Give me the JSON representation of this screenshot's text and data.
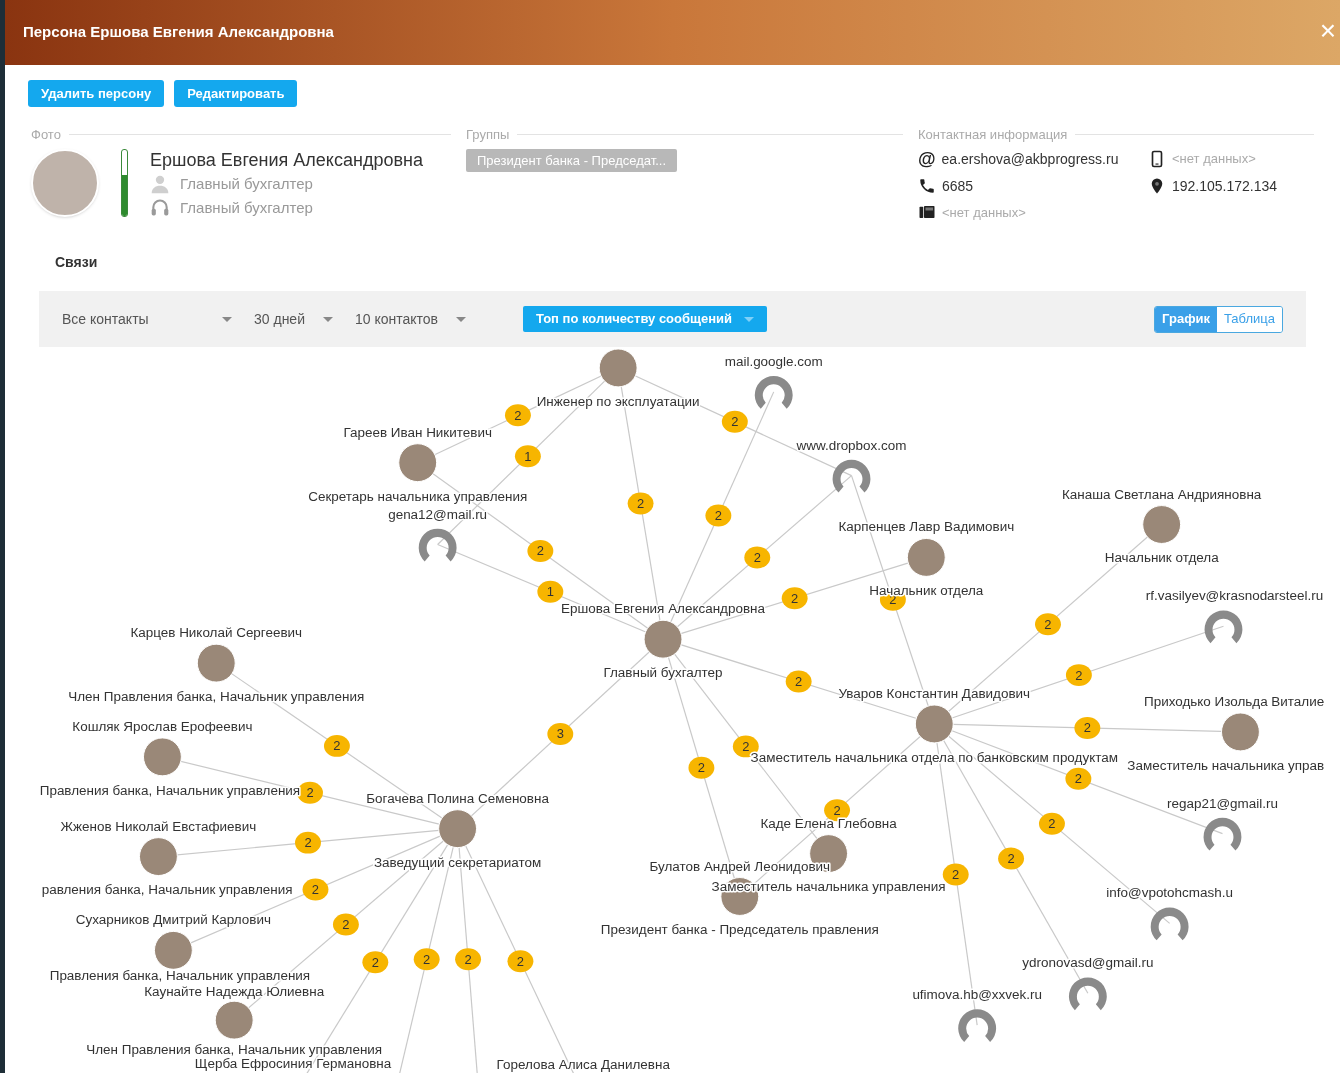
{
  "window": {
    "title": "Персона Ершова Евгения Александровна",
    "close": "×"
  },
  "actions": [
    "Удалить персону",
    "Редактировать"
  ],
  "photo": {
    "legend": "Фото",
    "level": 0.62,
    "name": "Ершова Евгения Александровна",
    "roles": [
      {
        "kind": "user",
        "text": "Главный бухгалтер"
      },
      {
        "kind": "headset",
        "text": "Главный бухгалтер"
      }
    ]
  },
  "groups": {
    "legend": "Группы",
    "tags": [
      "Президент банка - Председат..."
    ]
  },
  "contacts": {
    "legend": "Контактная информация",
    "items": [
      {
        "kind": "email",
        "icon": "@",
        "value": "ea.ershova@akbprogress.ru",
        "missing": false
      },
      {
        "kind": "mobile",
        "value": "<нет данных>",
        "missing": true
      },
      {
        "kind": "phone",
        "value": "6685",
        "missing": false
      },
      {
        "kind": "ip",
        "value": "192.105.172.134",
        "missing": false
      },
      {
        "kind": "fax",
        "value": "<нет данных>",
        "missing": true
      }
    ]
  },
  "links": {
    "title": "Связи",
    "filters": [
      {
        "kind": "plain",
        "label": "Все контакты"
      },
      {
        "kind": "plain",
        "label": "30 дней"
      },
      {
        "kind": "plain",
        "label": "10 контактов"
      },
      {
        "kind": "primary",
        "label": "Топ по количеству сообщений"
      }
    ],
    "views": [
      {
        "label": "График",
        "selected": true
      },
      {
        "label": "Таблица",
        "selected": false
      }
    ],
    "nodes": [
      {
        "kind": "person",
        "role": "Инженер по эксплуатации"
      },
      {
        "kind": "unknown",
        "name": "mail.google.com"
      },
      {
        "kind": "person",
        "name": "Гареев Иван Никитевич",
        "role": "Секретарь начальника управления"
      },
      {
        "kind": "unknown",
        "name": "www.dropbox.com"
      },
      {
        "kind": "person",
        "name": "Канаша Светлана Андрияновна",
        "role": "Начальник отдела"
      },
      {
        "kind": "unknown",
        "name": "gena12@mail.ru"
      },
      {
        "kind": "person",
        "name": "Карпенцев Лавр Вадимович",
        "role": "Начальник отдела"
      },
      {
        "kind": "unknown",
        "name": "rf.vasilyev@krasnodarsteel.ru"
      },
      {
        "kind": "person",
        "name": "Ершова Евгения Александровна",
        "role": "Главный бухгалтер"
      },
      {
        "kind": "person",
        "name": "Карцев Николай Сергеевич",
        "role": "Член Правления банка, Начальник управления"
      },
      {
        "kind": "person",
        "name": "Уваров Константин Давидович",
        "role": "Заместитель начальника отдела по банковским продуктам"
      },
      {
        "kind": "person",
        "name": "Приходько Изольда Виталие",
        "role": "Заместитель начальника управ"
      },
      {
        "kind": "person",
        "name": "Кошляк Ярослав Ерофеевич",
        "role": "Правления банка, Начальник управления"
      },
      {
        "kind": "person",
        "name": "Богачева Полина Семеновна",
        "role": "Заведущий секретариатом"
      },
      {
        "kind": "unknown",
        "name": "regap21@gmail.ru"
      },
      {
        "kind": "person",
        "name": "Жженов Николай Евстафиевич",
        "role": "равления банка, Начальник управления"
      },
      {
        "kind": "person",
        "name": "Каде Елена Глебовна",
        "role": "Заместитель начальника управления"
      },
      {
        "kind": "person",
        "name": "Булатов Андрей Леонидович",
        "role": "Президент банка - Председатель правления"
      },
      {
        "kind": "unknown",
        "name": "info@vpotohcmash.u"
      },
      {
        "kind": "person",
        "name": "Сухарников Дмитрий Карлович",
        "role": "Правления банка, Начальник управления"
      },
      {
        "kind": "unknown",
        "name": "ydronovasd@gmail.ru"
      },
      {
        "kind": "person",
        "name": "Каунайте Надежда Юлиевна",
        "role": "Член Правления банка, Начальник управления"
      },
      {
        "kind": "unknown",
        "name": "ufimova.hb@xxvek.ru"
      },
      {
        "kind": "person",
        "name": "Щерба Ефросиния Германовна"
      },
      {
        "kind": "person",
        "name": "Горелова Алиса Данилевна"
      }
    ],
    "edges": [
      {
        "count": "2"
      },
      {
        "count": "1"
      },
      {
        "count": "2"
      },
      {
        "count": "2"
      },
      {
        "count": "2"
      },
      {
        "count": "2"
      },
      {
        "count": "1"
      },
      {
        "count": "2"
      },
      {
        "count": "2"
      },
      {
        "count": "2"
      },
      {
        "count": "2"
      },
      {
        "count": "2"
      },
      {
        "count": "2"
      },
      {
        "count": "2"
      },
      {
        "count": "2"
      },
      {
        "count": "2"
      },
      {
        "count": "2"
      },
      {
        "count": "2"
      },
      {
        "count": "2"
      },
      {
        "count": "2"
      },
      {
        "count": "2"
      },
      {
        "count": "3"
      },
      {
        "count": "2"
      },
      {
        "count": "2"
      },
      {
        "count": "2"
      },
      {
        "count": "2"
      },
      {
        "count": "2"
      },
      {
        "count": "2"
      },
      {
        "count": "2"
      },
      {
        "count": "2"
      },
      {
        "count": "2"
      }
    ]
  }
}
